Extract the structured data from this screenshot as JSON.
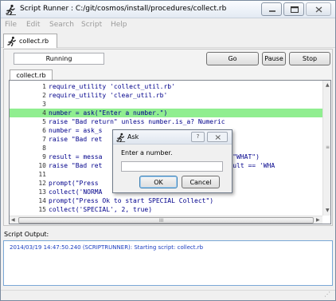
{
  "window": {
    "title": "Script Runner : C:/git/cosmos/install/procedures/collect.rb"
  },
  "menu": [
    {
      "label": "File"
    },
    {
      "label": "Edit"
    },
    {
      "label": "Search"
    },
    {
      "label": "Script"
    },
    {
      "label": "Help"
    }
  ],
  "top_tab": {
    "label": "collect.rb"
  },
  "controls": {
    "state": "Running",
    "go_label": "Go",
    "pause_label": "Pause",
    "stop_label": "Stop"
  },
  "file_tab": {
    "label": "collect.rb"
  },
  "editor": {
    "highlight_color": "#90ee90",
    "lines": [
      {
        "num": "1",
        "text": "require_utility 'collect_util.rb'"
      },
      {
        "num": "2",
        "text": "require_utility 'clear_util.rb'"
      },
      {
        "num": "3",
        "text": ""
      },
      {
        "num": "4",
        "text": "number = ask(\"Enter a number.\")"
      },
      {
        "num": "5",
        "text": "raise \"Bad return\" unless number.is_a? Numeric"
      },
      {
        "num": "6",
        "text": "number = ask_s"
      },
      {
        "num": "7",
        "text": "raise \"Bad ret                          ring"
      },
      {
        "num": "8",
        "text": ""
      },
      {
        "num": "9",
        "text": "result = messa                          \"BLAH\", \"WHAT\")"
      },
      {
        "num": "10",
        "text": "raise \"Bad ret                          ' or result == 'WHA"
      },
      {
        "num": "11",
        "text": ""
      },
      {
        "num": "12",
        "text": "prompt(\"Press                          )"
      },
      {
        "num": "13",
        "text": "collect('NORMA"
      },
      {
        "num": "14",
        "text": "prompt(\"Press Ok to start SPECIAL Collect\")"
      },
      {
        "num": "15",
        "text": "collect('SPECIAL', 2, true)"
      }
    ],
    "highlighted_line": 4
  },
  "dialog": {
    "title": "Ask",
    "help": "?",
    "prompt": "Enter a number.",
    "input_value": "",
    "ok_label": "OK",
    "cancel_label": "Cancel"
  },
  "output": {
    "label": "Script Output:",
    "lines": [
      "2014/03/19 14:47:50.240 (SCRIPTRUNNER): Starting script: collect.rb"
    ]
  },
  "icons": {
    "app": "running-man-icon",
    "tab": "running-man-icon",
    "dialog": "running-man-icon"
  },
  "scroll": {
    "hgrip": "III"
  }
}
